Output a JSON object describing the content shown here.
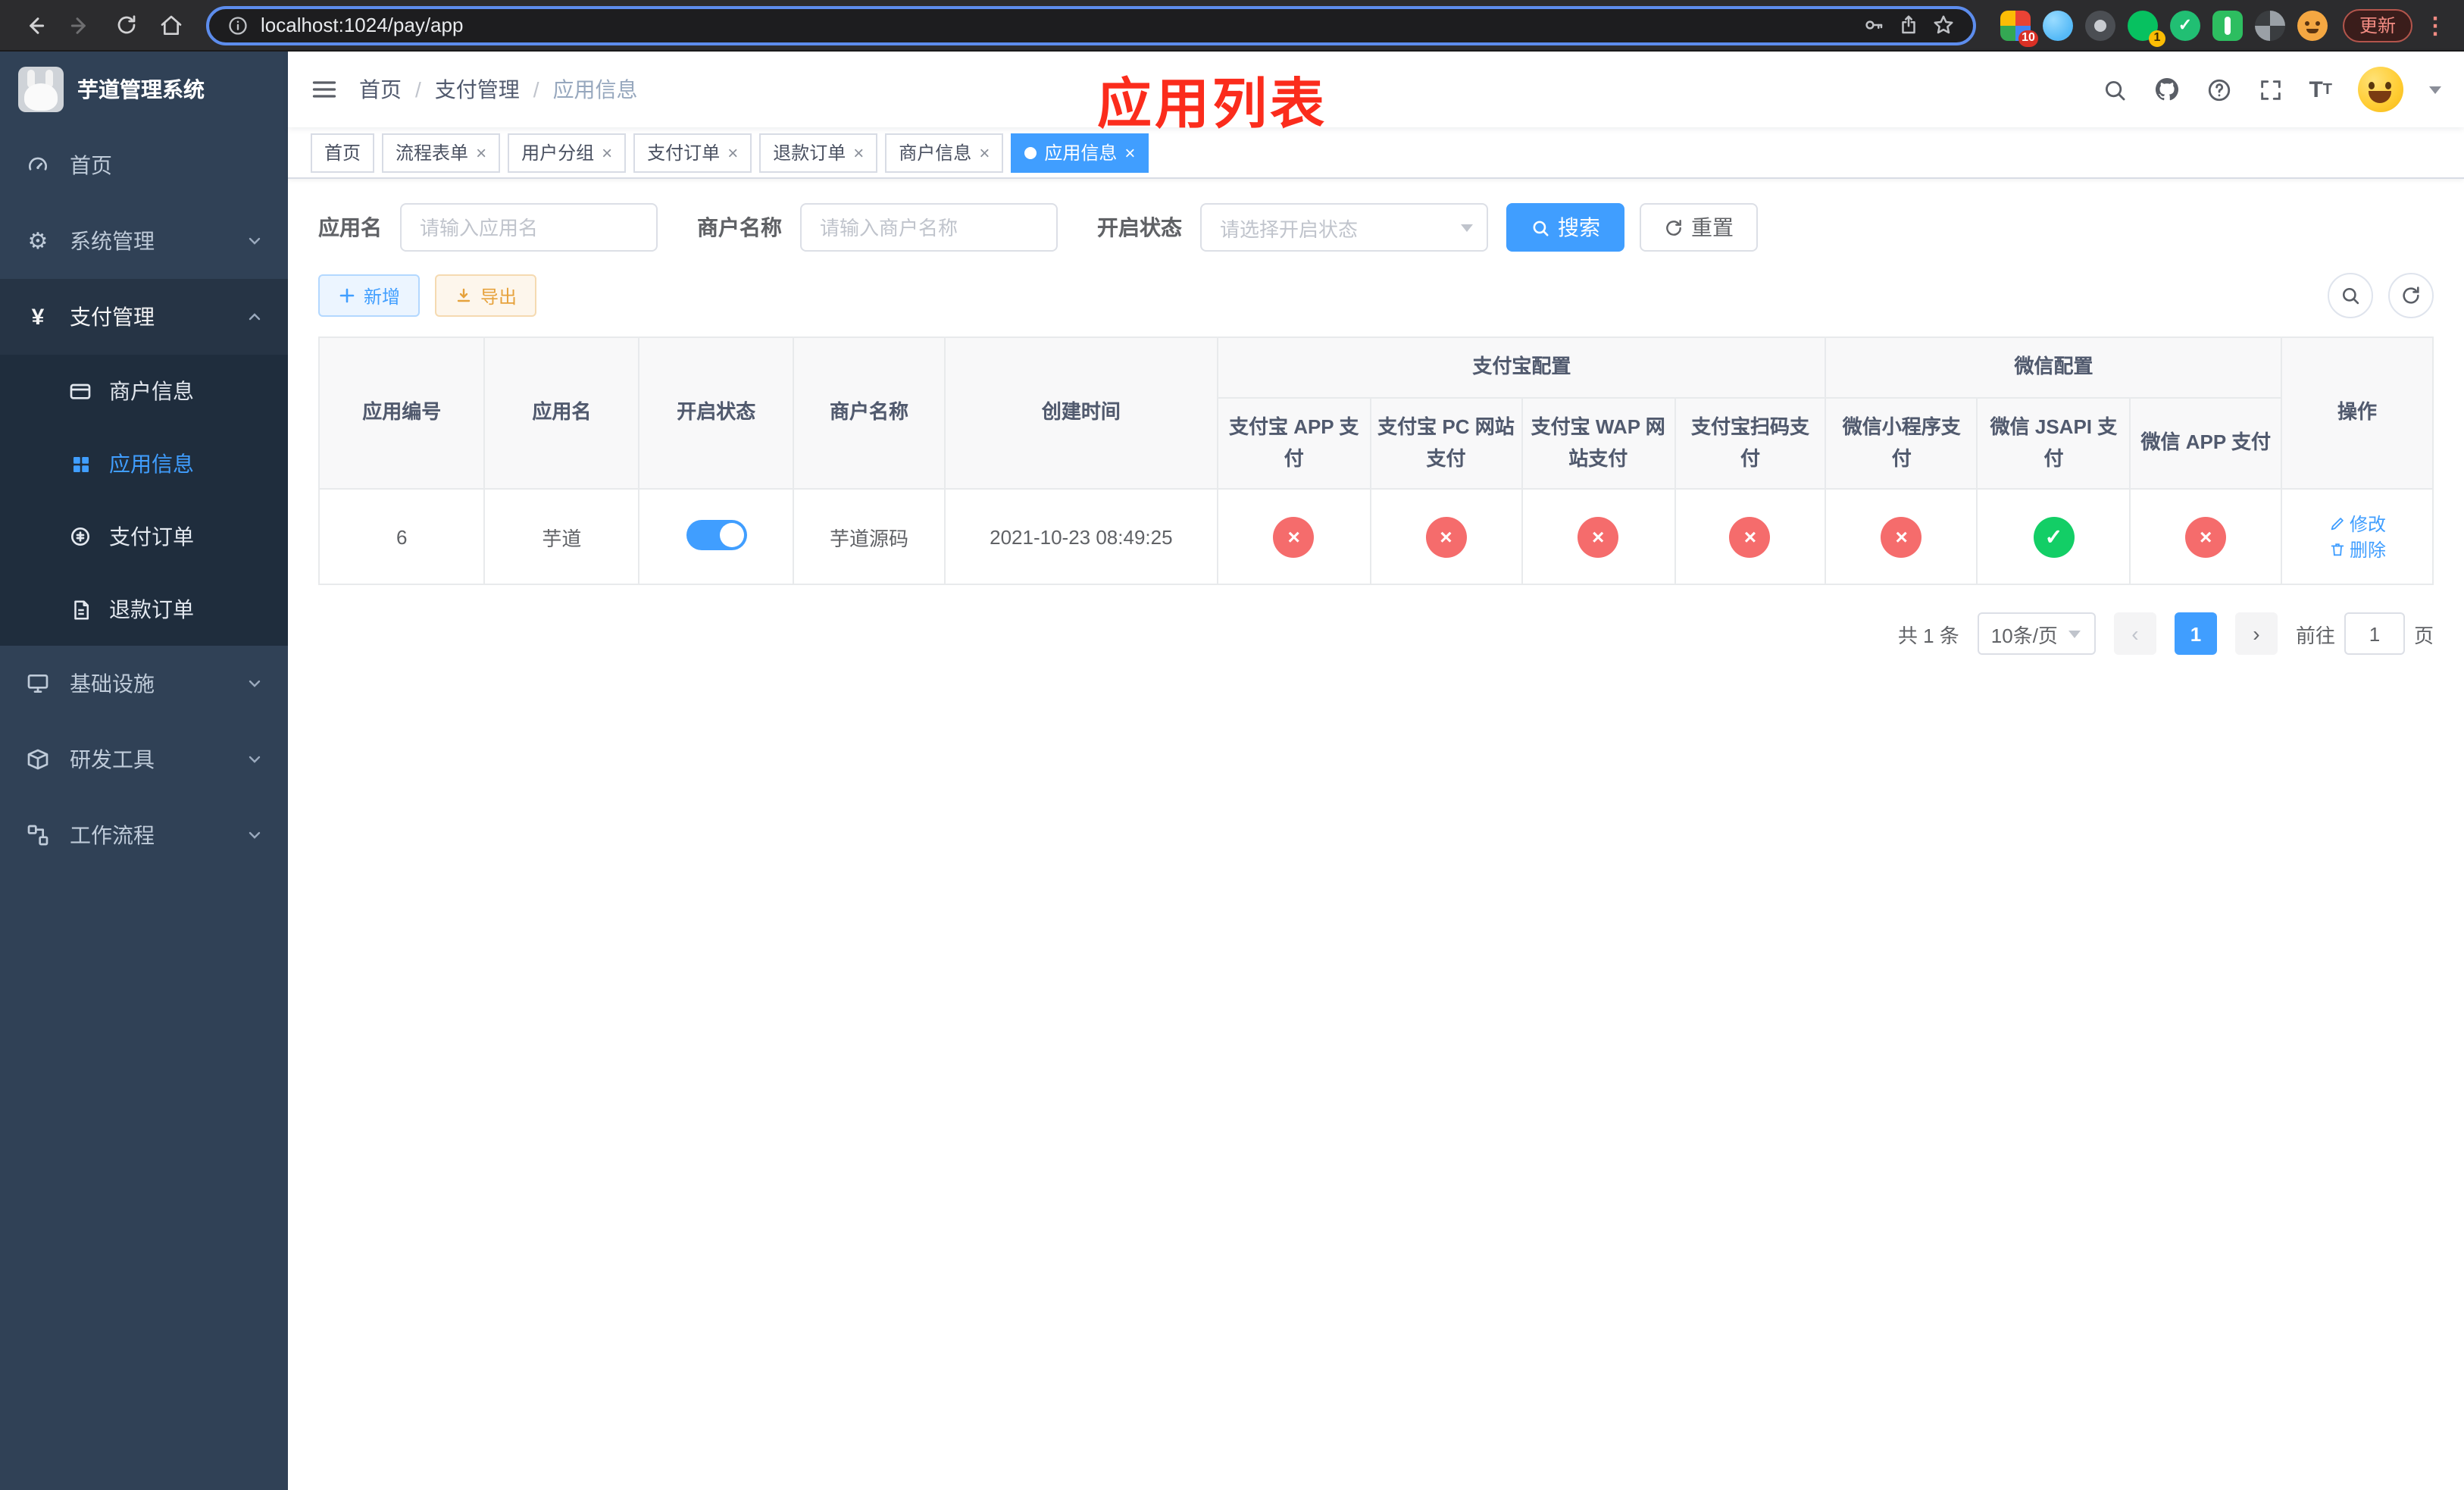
{
  "browser": {
    "url": "localhost:1024/pay/app",
    "update_label": "更新",
    "extension_badge_red": "10",
    "extension_badge_yellow": "1"
  },
  "annotation": {
    "title": "应用列表"
  },
  "sidebar": {
    "title": "芋道管理系统",
    "menu": [
      {
        "label": "首页"
      },
      {
        "label": "系统管理"
      },
      {
        "label": "支付管理"
      },
      {
        "label": "基础设施"
      },
      {
        "label": "研发工具"
      },
      {
        "label": "工作流程"
      }
    ],
    "payment_submenu": [
      {
        "label": "商户信息"
      },
      {
        "label": "应用信息"
      },
      {
        "label": "支付订单"
      },
      {
        "label": "退款订单"
      }
    ]
  },
  "navbar": {
    "breadcrumb": [
      "首页",
      "支付管理",
      "应用信息"
    ]
  },
  "tabs": [
    {
      "label": "首页"
    },
    {
      "label": "流程表单"
    },
    {
      "label": "用户分组"
    },
    {
      "label": "支付订单"
    },
    {
      "label": "退款订单"
    },
    {
      "label": "商户信息"
    },
    {
      "label": "应用信息"
    }
  ],
  "filters": {
    "app_name_label": "应用名",
    "app_name_placeholder": "请输入应用名",
    "merchant_label": "商户名称",
    "merchant_placeholder": "请输入商户名称",
    "status_label": "开启状态",
    "status_placeholder": "请选择开启状态",
    "search_label": "搜索",
    "reset_label": "重置"
  },
  "toolbar": {
    "add_label": "新增",
    "export_label": "导出"
  },
  "table": {
    "headers": {
      "app_id": "应用编号",
      "app_name": "应用名",
      "status": "开启状态",
      "merchant_name": "商户名称",
      "create_time": "创建时间",
      "alipay_group": "支付宝配置",
      "wechat_group": "微信配置",
      "actions": "操作",
      "alipay_app": "支付宝 APP 支付",
      "alipay_pc": "支付宝 PC 网站支付",
      "alipay_wap": "支付宝 WAP 网站支付",
      "alipay_qr": "支付宝扫码支付",
      "wechat_lite": "微信小程序支付",
      "wechat_jsapi": "微信 JSAPI 支付",
      "wechat_app": "微信 APP 支付"
    },
    "rows": [
      {
        "app_id": "6",
        "app_name": "芋道",
        "status_on": true,
        "merchant_name": "芋道源码",
        "create_time": "2021-10-23 08:49:25",
        "alipay_app_enabled": false,
        "alipay_pc_enabled": false,
        "alipay_wap_enabled": false,
        "alipay_qr_enabled": false,
        "wechat_lite_enabled": false,
        "wechat_jsapi_enabled": true,
        "wechat_app_enabled": false,
        "edit_label": "修改",
        "delete_label": "删除"
      }
    ]
  },
  "pagination": {
    "total_text": "共 1 条",
    "page_size_text": "10条/页",
    "current_page": "1",
    "goto_prefix": "前往",
    "goto_value": "1",
    "goto_suffix": "页"
  },
  "colors": {
    "primary": "#409eff",
    "danger": "#f56c6c",
    "success": "#13ce66",
    "warning": "#e6a23c",
    "sidebar_bg": "#304156",
    "submenu_bg": "#1f2d3d",
    "annotation_red": "#fb2c1c"
  }
}
